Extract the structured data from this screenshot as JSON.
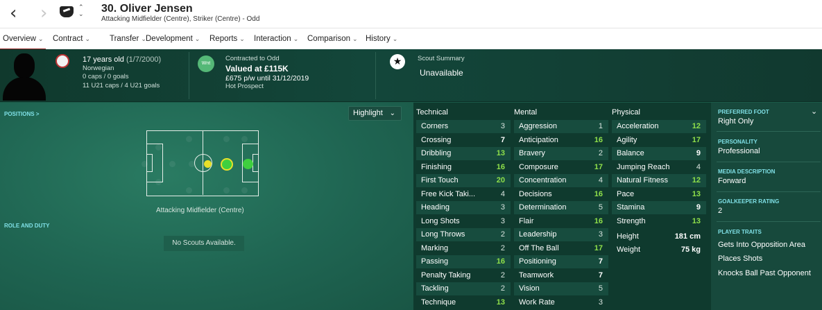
{
  "header": {
    "back_icon": "‹",
    "forward_icon": "›",
    "updown_icon": "⌃⌄",
    "player_name": "30. Oliver Jensen",
    "subtitle": "Attacking Midfielder (Centre), Striker (Centre) - Odd"
  },
  "tabs": [
    {
      "label": "Overview"
    },
    {
      "label": "Contract"
    },
    {
      "label": "Transfer"
    },
    {
      "label": "Development"
    },
    {
      "label": "Reports"
    },
    {
      "label": "Interaction"
    },
    {
      "label": "Comparison"
    },
    {
      "label": "History"
    }
  ],
  "profile": {
    "age": "17 years old",
    "dob": "(1/7/2000)",
    "nationality": "Norwegian",
    "caps": "0 caps / 0 goals",
    "u21": "11 U21 caps / 4 U21 goals"
  },
  "contract": {
    "badge": "Wnt",
    "label": "Contracted to Odd",
    "value": "Valued at £115K",
    "wage": "£675 p/w until 31/12/2019",
    "status": "Hot Prospect"
  },
  "scout": {
    "label": "Scout Summary",
    "value": "Unavailable"
  },
  "positions": {
    "title": "POSITIONS >",
    "highlight_label": "Highlight",
    "position_caption": "Attacking Midfielder (Centre)",
    "role_title": "ROLE AND DUTY",
    "no_scouts": "No Scouts Available."
  },
  "colors": {
    "attr_green": "#8fe04a",
    "attr_normal": "#d8e4df",
    "dot_yellow": "#e8e02a",
    "dot_green": "#3fcf3f"
  },
  "attributes": {
    "technical": {
      "title": "Technical",
      "rows": [
        {
          "name": "Corners",
          "value": "3"
        },
        {
          "name": "Crossing",
          "value": "7"
        },
        {
          "name": "Dribbling",
          "value": "13"
        },
        {
          "name": "Finishing",
          "value": "16"
        },
        {
          "name": "First Touch",
          "value": "20"
        },
        {
          "name": "Free Kick Taki...",
          "value": "4"
        },
        {
          "name": "Heading",
          "value": "3"
        },
        {
          "name": "Long Shots",
          "value": "3"
        },
        {
          "name": "Long Throws",
          "value": "2"
        },
        {
          "name": "Marking",
          "value": "2"
        },
        {
          "name": "Passing",
          "value": "16"
        },
        {
          "name": "Penalty Taking",
          "value": "2"
        },
        {
          "name": "Tackling",
          "value": "2"
        },
        {
          "name": "Technique",
          "value": "13"
        }
      ]
    },
    "mental": {
      "title": "Mental",
      "rows": [
        {
          "name": "Aggression",
          "value": "1"
        },
        {
          "name": "Anticipation",
          "value": "16"
        },
        {
          "name": "Bravery",
          "value": "2"
        },
        {
          "name": "Composure",
          "value": "17"
        },
        {
          "name": "Concentration",
          "value": "4"
        },
        {
          "name": "Decisions",
          "value": "16"
        },
        {
          "name": "Determination",
          "value": "5"
        },
        {
          "name": "Flair",
          "value": "16"
        },
        {
          "name": "Leadership",
          "value": "3"
        },
        {
          "name": "Off The Ball",
          "value": "17"
        },
        {
          "name": "Positioning",
          "value": "7"
        },
        {
          "name": "Teamwork",
          "value": "7"
        },
        {
          "name": "Vision",
          "value": "5"
        },
        {
          "name": "Work Rate",
          "value": "3"
        }
      ]
    },
    "physical": {
      "title": "Physical",
      "rows": [
        {
          "name": "Acceleration",
          "value": "12"
        },
        {
          "name": "Agility",
          "value": "17"
        },
        {
          "name": "Balance",
          "value": "9"
        },
        {
          "name": "Jumping Reach",
          "value": "4"
        },
        {
          "name": "Natural Fitness",
          "value": "12"
        },
        {
          "name": "Pace",
          "value": "13"
        },
        {
          "name": "Stamina",
          "value": "9"
        },
        {
          "name": "Strength",
          "value": "13"
        }
      ],
      "height_label": "Height",
      "height_value": "181 cm",
      "weight_label": "Weight",
      "weight_value": "75 kg"
    }
  },
  "sidebar": {
    "preferred_foot_label": "PREFERRED FOOT",
    "preferred_foot": "Right Only",
    "personality_label": "PERSONALITY",
    "personality": "Professional",
    "media_label": "MEDIA DESCRIPTION",
    "media": "Forward",
    "gk_label": "GOALKEEPER RATING",
    "gk": "2",
    "traits_label": "PLAYER TRAITS",
    "traits": [
      "Gets Into Opposition Area",
      "Places Shots",
      "Knocks Ball Past Opponent"
    ]
  }
}
